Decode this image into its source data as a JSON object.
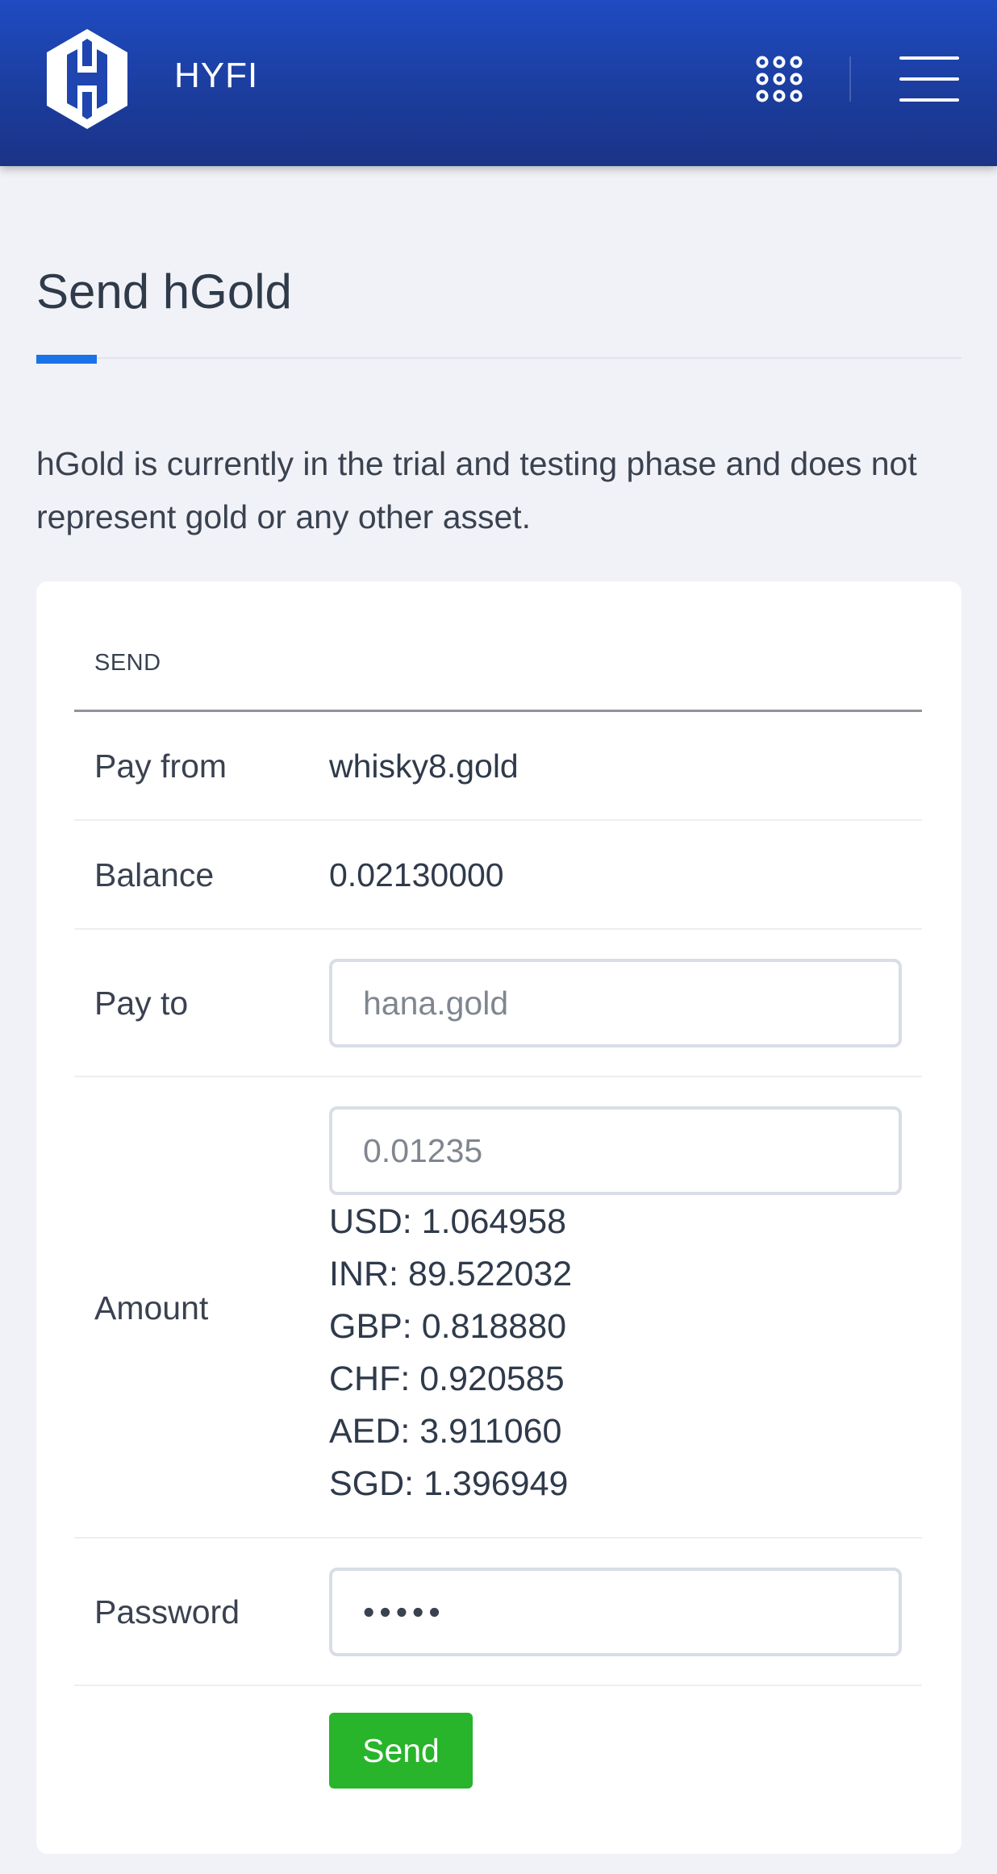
{
  "header": {
    "brand": "HYFI",
    "logo_icon": "hyfi-logo-icon",
    "apps_icon": "apps-grid-icon",
    "menu_icon": "hamburger-menu-icon",
    "colors": {
      "background": "#1f4bc2",
      "text": "#ffffff"
    }
  },
  "page": {
    "title": "Send hGold",
    "accent_color": "#1a73e8",
    "notice": "hGold is currently in the trial and testing phase and does not represent gold or any other asset."
  },
  "form": {
    "heading": "SEND",
    "pay_from_label": "Pay from",
    "pay_from_value": "whisky8.gold",
    "balance_label": "Balance",
    "balance_value": "0.02130000",
    "pay_to_label": "Pay to",
    "pay_to_placeholder": "hana.gold",
    "amount_label": "Amount",
    "amount_placeholder": "0.01235",
    "conversions": [
      "USD: 1.064958",
      "INR: 89.522032",
      "GBP: 0.818880",
      "CHF: 0.920585",
      "AED: 3.911060",
      "SGD: 1.396949"
    ],
    "password_label": "Password",
    "password_value": "•••••",
    "send_label": "Send",
    "send_color": "#28b42b"
  }
}
